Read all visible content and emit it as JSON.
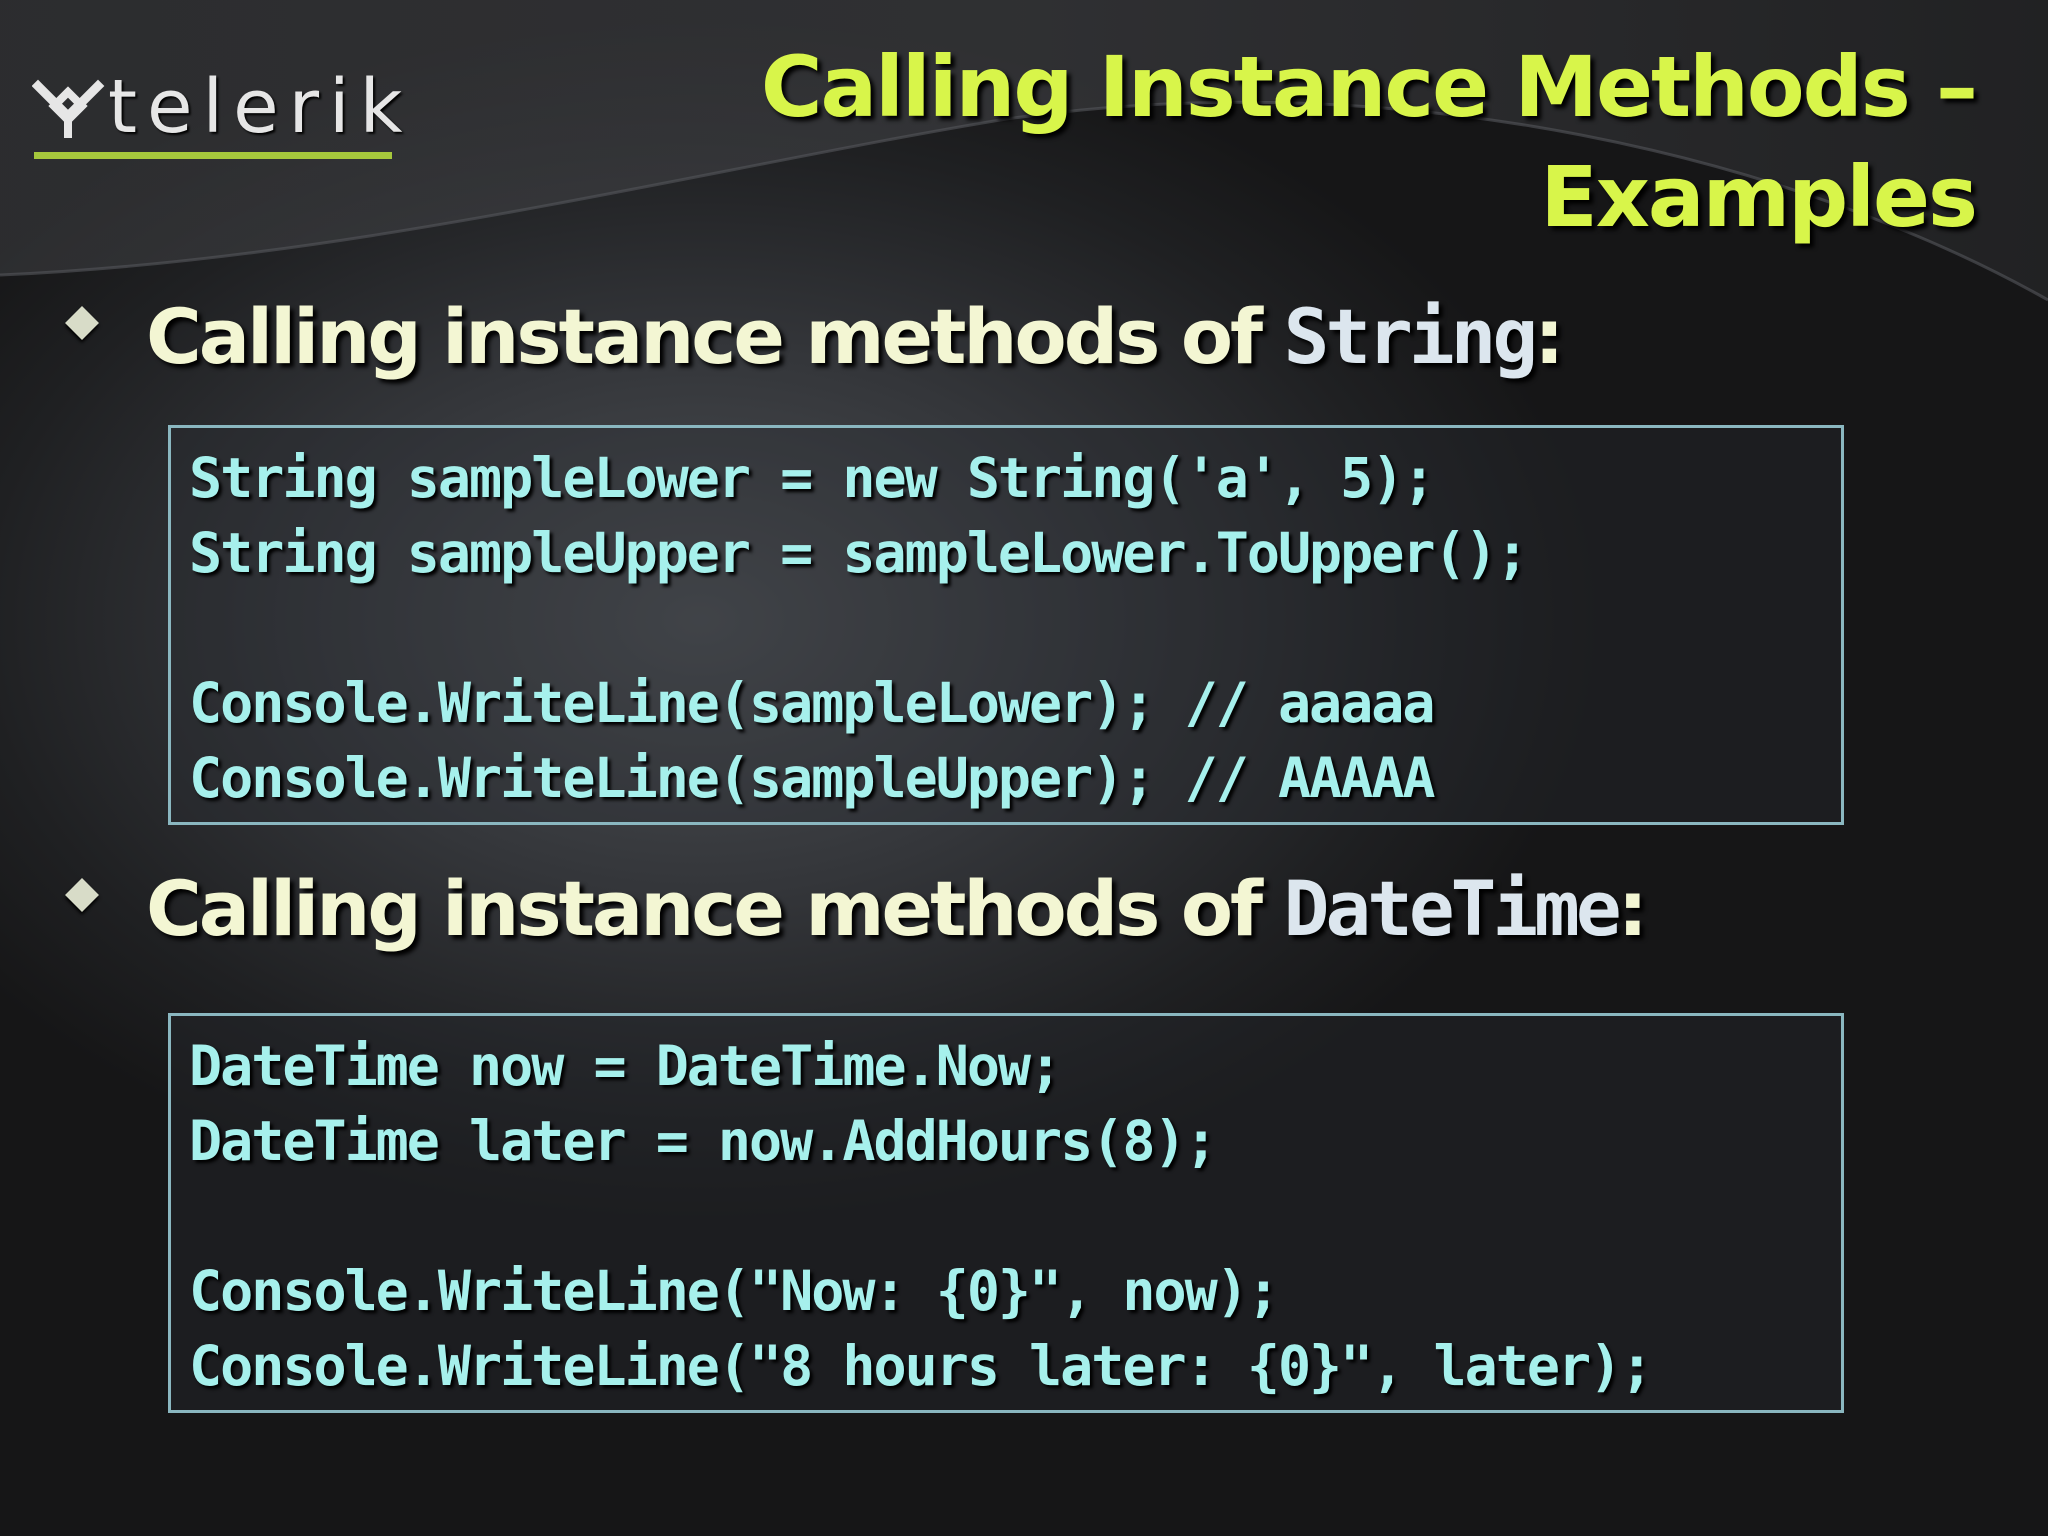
{
  "logo": {
    "text": "telerik"
  },
  "title": {
    "line1": "Calling Instance Methods –",
    "line2": "Examples"
  },
  "bullets": [
    {
      "prefix": "Calling instance methods of ",
      "code": "String",
      "suffix": ":"
    },
    {
      "prefix": "Calling instance methods of ",
      "code": "DateTime",
      "suffix": ":"
    }
  ],
  "code_blocks": [
    {
      "lines": [
        "String sampleLower = new String('a', 5);",
        "String sampleUpper = sampleLower.ToUpper();",
        "",
        "Console.WriteLine(sampleLower); // aaaaa",
        "Console.WriteLine(sampleUpper); // AAAAA"
      ]
    },
    {
      "lines": [
        "DateTime now = DateTime.Now;",
        "DateTime later = now.AddHours(8);",
        "",
        "Console.WriteLine(\"Now: {0}\", now);",
        "Console.WriteLine(\"8 hours later: {0}\", later);"
      ]
    }
  ],
  "colors": {
    "title": "#d8f54a",
    "bullet_text": "#f3f6d3",
    "code_text": "#a6f0ec",
    "code_border": "#8ab7c0",
    "logo_underline": "#a6c83c"
  }
}
